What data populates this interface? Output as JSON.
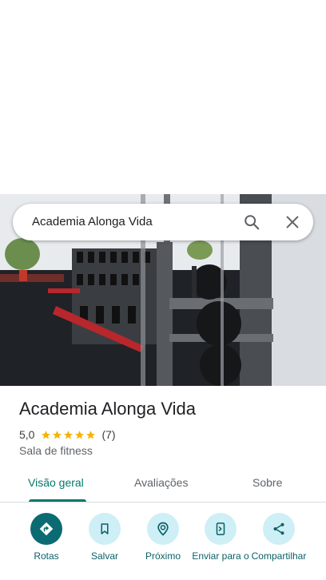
{
  "search": {
    "query": "Academia Alonga Vida"
  },
  "place": {
    "name": "Academia Alonga Vida",
    "rating": "5,0",
    "stars_filled": 5,
    "review_count": "(7)",
    "category": "Sala de fitness"
  },
  "tabs": [
    {
      "label": "Visão geral",
      "active": true
    },
    {
      "label": "Avaliações",
      "active": false
    },
    {
      "label": "Sobre",
      "active": false
    }
  ],
  "actions": [
    {
      "label": "Rotas",
      "icon": "directions-icon"
    },
    {
      "label": "Salvar",
      "icon": "bookmark-icon"
    },
    {
      "label": "Próximo",
      "icon": "nearby-icon"
    },
    {
      "label": "Enviar para o",
      "icon": "send-to-phone-icon"
    },
    {
      "label": "Compartilhar",
      "icon": "share-icon"
    }
  ],
  "colors": {
    "accent": "#00796b",
    "action_primary": "#0b6b73",
    "action_bg": "#cdeff5",
    "star": "#f4b400"
  }
}
